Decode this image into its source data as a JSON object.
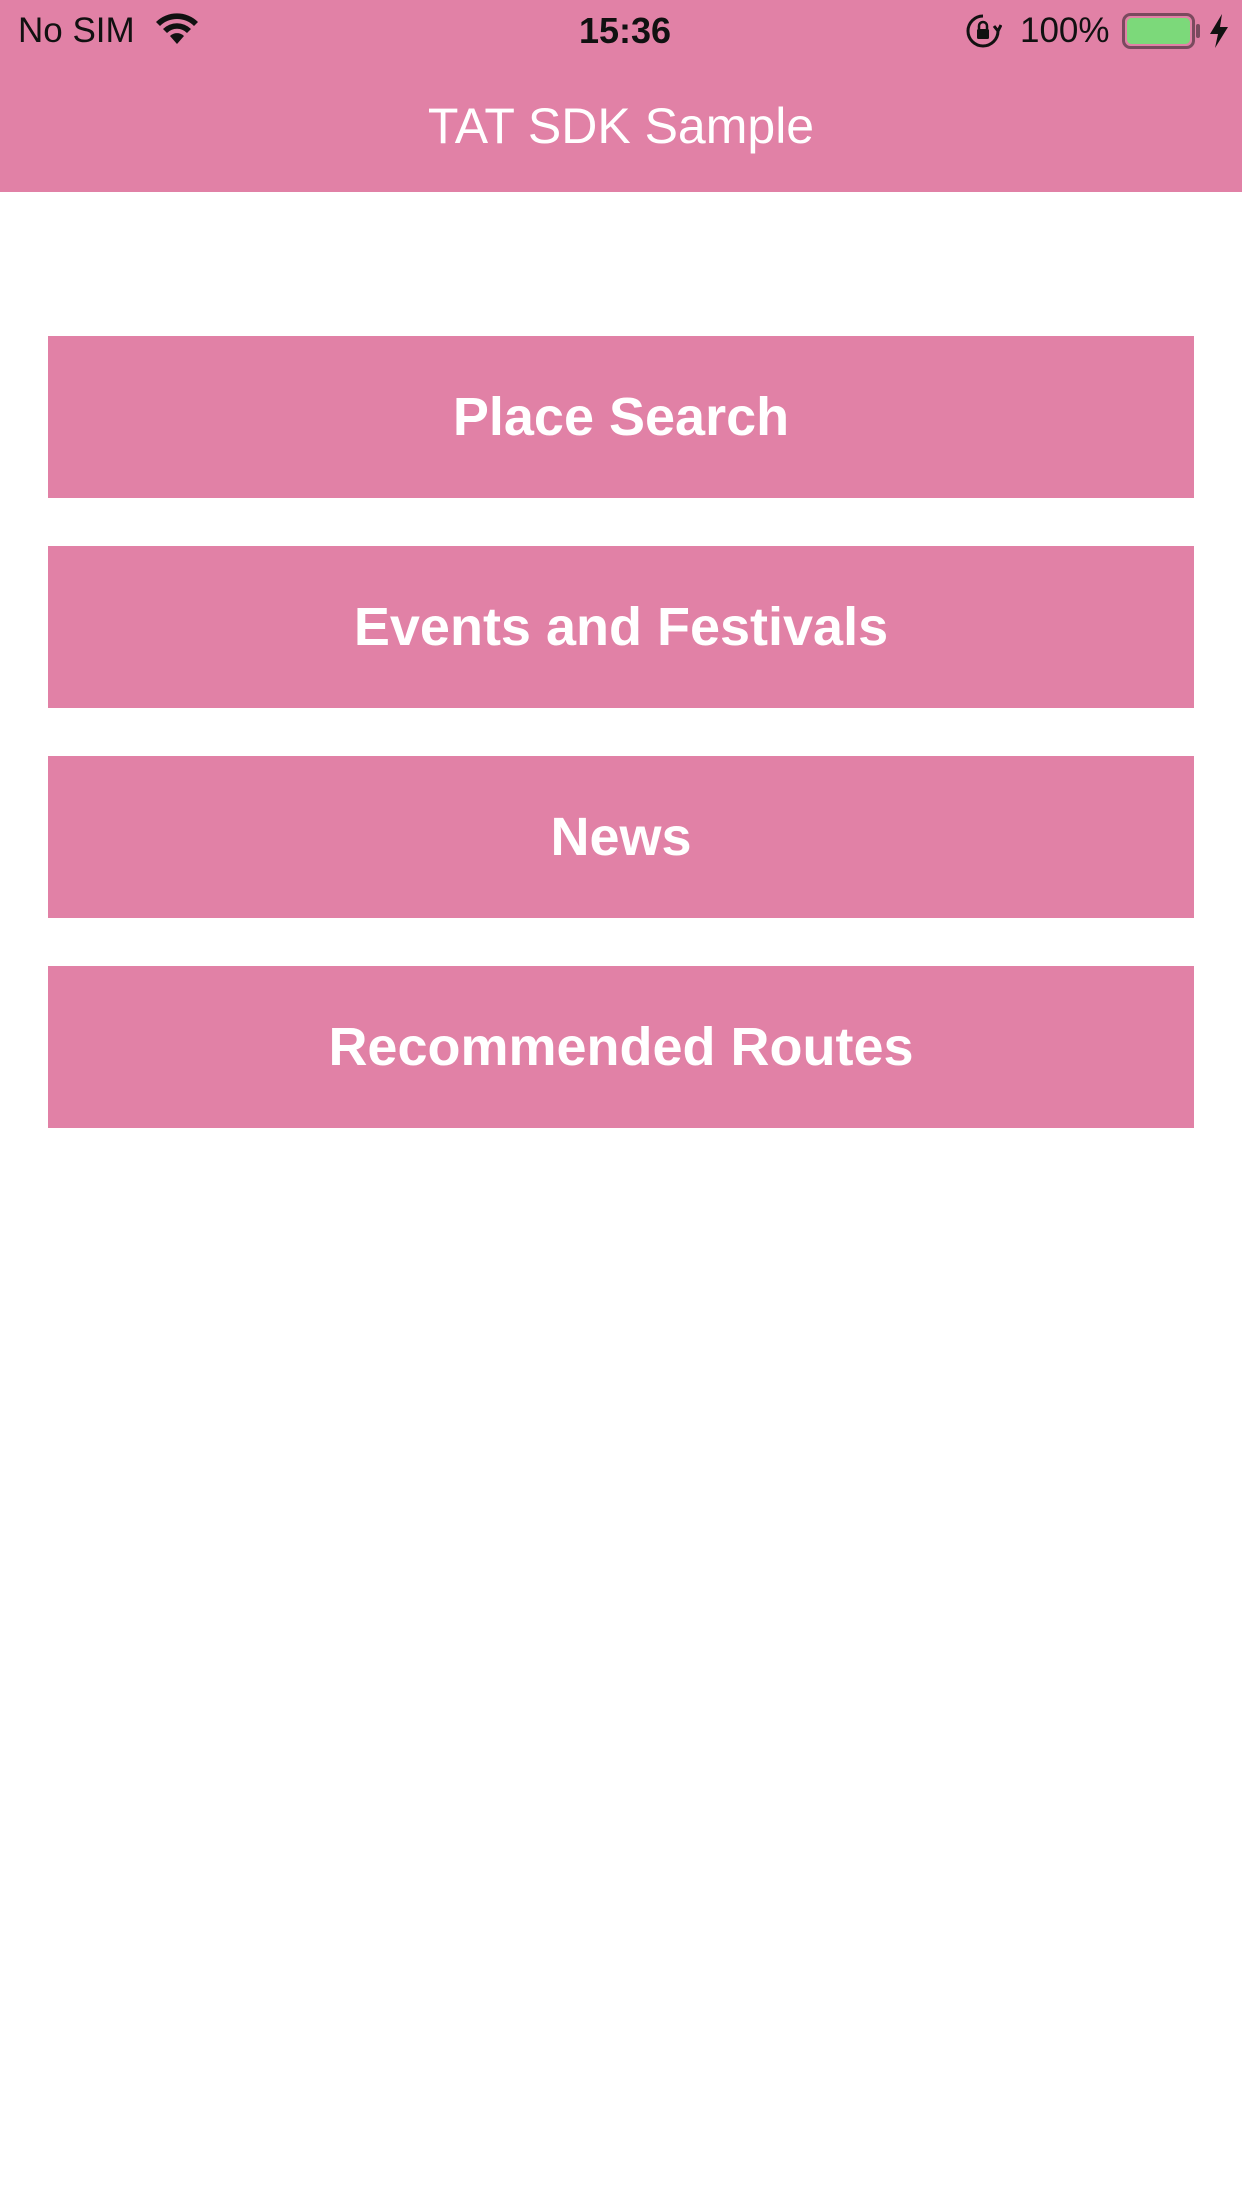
{
  "status_bar": {
    "carrier": "No SIM",
    "time": "15:36",
    "battery": "100%",
    "icons": [
      "wifi-icon",
      "rotation-lock-icon",
      "battery-icon",
      "charging-bolt-icon"
    ],
    "battery_level": 1.0
  },
  "nav_bar": {
    "title": "TAT SDK Sample"
  },
  "menu": {
    "items": [
      {
        "label": "Place Search"
      },
      {
        "label": "Events and Festivals"
      },
      {
        "label": "News"
      },
      {
        "label": "Recommended Routes"
      }
    ]
  },
  "colors": {
    "accent": "#e181a6",
    "background": "#ffffff",
    "button_text": "#ffffff",
    "battery_fill": "#7cd97a"
  }
}
